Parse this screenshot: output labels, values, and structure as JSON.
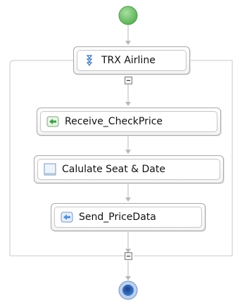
{
  "diagram": {
    "start_event": {
      "name": "start"
    },
    "sequence": {
      "label": "TRX Airline",
      "icon": "sequence-icon",
      "collapse_top": "collapse-toggle",
      "collapse_bottom": "collapse-toggle"
    },
    "activities": [
      {
        "label": "Receive_CheckPrice",
        "icon": "receive-icon"
      },
      {
        "label": "Calulate Seat & Date",
        "icon": "assign-icon"
      },
      {
        "label": "Send_PriceData",
        "icon": "send-icon"
      }
    ],
    "end_event": {
      "name": "end"
    },
    "colors": {
      "start_green": "#6fbf6a",
      "end_blue": "#2e6fc0",
      "connector": "#b8b8b8",
      "receive_green": "#3e9b45",
      "send_blue": "#4f8fd6"
    }
  }
}
